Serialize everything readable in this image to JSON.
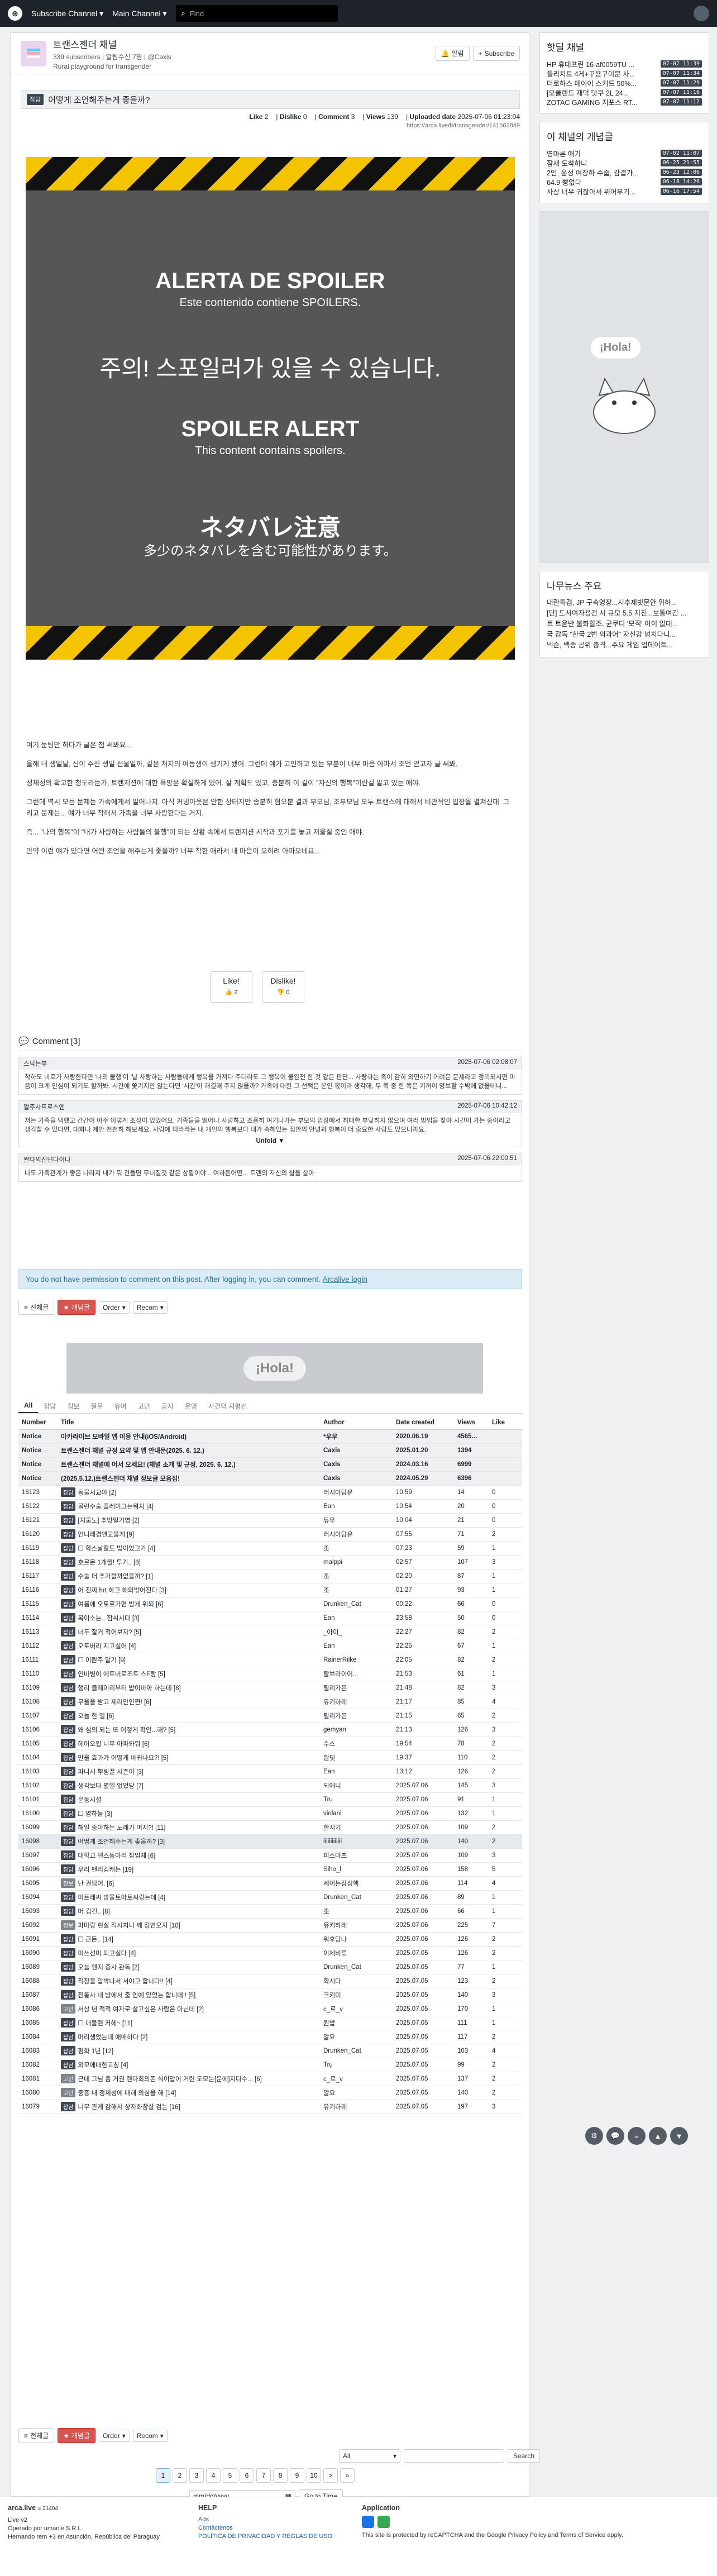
{
  "nav": {
    "board_label": "Subscribe Channel ▾",
    "main_label": "Main Channel ▾",
    "search_placeholder": "Find"
  },
  "channel": {
    "name": "트랜스젠더 채널",
    "meta": "339 subscribers | 알림수신 7명 | @Caxis",
    "desc": "Rural playground for transgender",
    "notify_label": "알림",
    "subscribe_label": "Subscribe"
  },
  "post": {
    "category": "잡담",
    "title": "어떻게 조언해주는게 좋을까?",
    "like_label": "Like",
    "like": "2",
    "dislike_label": "Dislike",
    "dislike": "0",
    "comment_label": "Comment",
    "comment": "3",
    "views_label": "Views",
    "views": "139",
    "uploaded_label": "Uploaded date",
    "uploaded": "2025-07-06 01:23:04",
    "url": "https://arca.live/b/transgender/141562849"
  },
  "spoiler": {
    "es_title": "ALERTA DE SPOILER",
    "es_sub": "Este contenido contiene SPOILERS.",
    "ko": "주의! 스포일러가 있을 수 있습니다.",
    "en_title": "SPOILER ALERT",
    "en_sub": "This content contains spoilers.",
    "ja_title": "ネタバレ注意",
    "ja_sub": "多少のネタバレを含む可能性があります。"
  },
  "body": [
    "여기 눈팅만 하다가 글은 첨 써봐요...",
    "올해 내 생일날, 신이 주신 생일 선물일까, 같은 처지의 여동생이 생기게 됐어. 그런데 얘가 고민하고 있는 부분이 너무 마음 아파서 조언 얻고자 글 써봐.",
    "정체성의 확고한 청도라든가, 트랜지션에 대한 욕망은 확실하게 있어. 잘 계획도 있고, 충분히 이 길이 \"자신의 행복\"이란걸 알고 있는 애야.",
    "그런데 역시 모든 문제는 가족에게서 일어나지. 아직 커밍아웃은 안한 상태지만 종분히 혐오분 결과 부모님, 조부모님 모두 트랜스에 대해서 비관적인 입장을 펼쳐신대. 그리고 문제는... 얘가 너무 착해서 가족을 너무 사랑한다는 거지.",
    "즉... \"나의 행복\"이 \"내가 사랑하는 사람들의 불행\"이 되는 상황 속에서 트랜지션 시작과 포기를 놓고 저울질 중인 애야.",
    "만약 이런 얘가 있다면 어떤 조언을 해주는게 좋을까? 너무 착한 애라서 내 마음이 오히려 아파오네요..."
  ],
  "votes": {
    "like_label": "Like!",
    "like_count": "2",
    "dislike_label": "Dislike!",
    "dislike_count": "0"
  },
  "comments": {
    "title": "Comment [3]",
    "items": [
      {
        "author": "스낙는부",
        "time": "2025-07-06 02:08:07",
        "text": "착하도 비로가 사랑한다면 '나의 불행'이 '날 사랑하는 사람들에게 행복을 가져다 주더라도 그 행복이 불완전 한 것 같은 판단... 사랑하는 족이 감히 외면하기 어려운 문제라고 정리되시면 마음이 크게 안심이 되기도 할까봐. 시간에 쫓기지만 않는다면 '시간'이 해결해 주지 않을까? 가족에 대한 그 선택은 본인 몫이라 생각해, 두 쪽 중 한 쪽은 기꺼이 양보할 수밖에 없을테니..."
      },
      {
        "author": "알주사트로스엔",
        "time": "2025-07-06 10:42:12",
        "text": "저는 가족을 택했고 간간이 아주 이렇게 조상이 있었어요. 거족들을 떨어나 사람하고 조용히 여기나가는 부모의 입장에서 최대한 부딪히지 않으며 여러 방법을 찾아 시간이 가는 중이라고 생각할 수 있다면, 대화나 제안 천천히 해보세요. 사람에 따라라는 내 개인의 행복보다 내가 속해있는 집안의 안녕과 행복이 더 중요한 사람도 있으니까요.",
        "unfold": "Unfold ▼"
      },
      {
        "author": "완다외진딘다이나",
        "time": "2025-07-06 22:00:51",
        "text": "나도 가족관계가 좋은 나라지 내가 뭐 건들면 무너질것 같은 상황이야... 여하튼어떤... 트랜의 자신의 삶을 살아"
      }
    ]
  },
  "notice": {
    "text": "You do not have permission to comment on this post. After logging in, you can comment.",
    "link": "Arcalive login"
  },
  "controls": {
    "all": "전체글",
    "hot": "개념글",
    "order": "Order",
    "recom": "Recom"
  },
  "ad": {
    "text": "¡Hola!"
  },
  "cats": [
    "All",
    "잡담",
    "정보",
    "질문",
    "유머",
    "고민",
    "공지",
    "운영",
    "사건의 지평선"
  ],
  "table": {
    "headers": [
      "Number",
      "Title",
      "Author",
      "Date created",
      "Views",
      "Like"
    ],
    "notices": [
      [
        "Notice",
        "아카라이브 모바일 앱 이용 안내(iOS/Android)",
        "*우우",
        "2020.06.19",
        "4565...",
        ""
      ],
      [
        "Notice",
        "트랜스젠더 채널 규정 요약 및 앱 안내문(2025. 6. 12.)",
        "Caxis",
        "2025.01.20",
        "1394",
        ""
      ],
      [
        "Notice",
        "트랜스젠더 채널에 어서 오세요! (채널 소개 및 규정, 2025. 6. 12.)",
        "Caxis",
        "2024.03.16",
        "6999",
        ""
      ],
      [
        "Notice",
        "(2025.5.12.)트랜스젠더 채널 정보글 모음집!",
        "Caxis",
        "2024.05.29",
        "6396",
        ""
      ]
    ],
    "rows": [
      [
        "16123",
        "잡담",
        "동물시교야 [2]",
        "러시아탐유",
        "10:59",
        "14",
        "0"
      ],
      [
        "16122",
        "잡담",
        "골런수술 플레이그는뭐지 [4]",
        "Ean",
        "10:54",
        "20",
        "0"
      ],
      [
        "16121",
        "잡담",
        "[지울노] 추방일기영 [2]",
        "듀우",
        "10:04",
        "21",
        "0"
      ],
      [
        "16120",
        "잡담",
        "언니래겸엔교블게 [9]",
        "러시아탐유",
        "07:55",
        "71",
        "2"
      ],
      [
        "16119",
        "잡담",
        "☐ 학스날절도 밥이었고가 [4]",
        "조",
        "07:23",
        "59",
        "1"
      ],
      [
        "16118",
        "잡담",
        "호르몬 1개월! 투기.. [8]",
        "malppi",
        "02:57",
        "107",
        "3"
      ],
      [
        "16117",
        "잡담",
        "수술 더 추가할까없을까? [1]",
        "조",
        "02:20",
        "87",
        "1"
      ],
      [
        "16116",
        "잡담",
        "어 진짜 hrt 하고 해와밖어진다 [3]",
        "조",
        "01:27",
        "93",
        "1"
      ],
      [
        "16115",
        "잡담",
        "여름에 오토로가면 방게 위되 [6]",
        "Drunken_Cat",
        "00:22",
        "66",
        "0"
      ],
      [
        "16114",
        "잡담",
        "목이소는.. 잠씨시다 [3]",
        "Ean",
        "23:58",
        "50",
        "0"
      ],
      [
        "16113",
        "잡담",
        "너두 잘거 적어보자? [5]",
        "_아이_",
        "22:27",
        "82",
        "2"
      ],
      [
        "16112",
        "잡담",
        "오토버리 지고실어 [4]",
        "Ean",
        "22:25",
        "67",
        "1"
      ],
      [
        "16111",
        "잡담",
        "☐ 이쁜주 알기 [9]",
        "RainerRilke",
        "22:05",
        "82",
        "2"
      ],
      [
        "16110",
        "잡담",
        "인바병이 에트버로조트 스F랑 [5]",
        "랄브라이어...",
        "21:53",
        "61",
        "1"
      ],
      [
        "16109",
        "잡담",
        "행리 클레이리부터 밥이바아 하는데 [8]",
        "릴리가온",
        "21:48",
        "82",
        "3"
      ],
      [
        "16108",
        "잡담",
        "무울을 받고 제리안인쨘! [6]",
        "유키하레",
        "21:17",
        "85",
        "4"
      ],
      [
        "16107",
        "잡담",
        "오늘 한 일 [6]",
        "릴리가온",
        "21:15",
        "65",
        "2"
      ],
      [
        "16106",
        "잡담",
        "왜 심의 되는 또 어떻게 확인...해? [5]",
        "gemyan",
        "21:13",
        "126",
        "3"
      ],
      [
        "16105",
        "잡담",
        "헤어오입 너무 아파와뭐 [6]",
        "수스",
        "19:54",
        "78",
        "2"
      ],
      [
        "16104",
        "잡담",
        "만울 효과가 어떻게 바뀌나요?! [5]",
        "딸딧",
        "19:37",
        "110",
        "2"
      ],
      [
        "16103",
        "잡담",
        "파니시 뿌링꿀 시즌이 [3]",
        "Ean",
        "13:12",
        "126",
        "2"
      ],
      [
        "16102",
        "잡담",
        "생각보다 별일 없었당 [7]",
        "되에니",
        "2025.07.06",
        "145",
        "3"
      ],
      [
        "16101",
        "잡담",
        "운동시설",
        "Trụ",
        "2025.07.06",
        "91",
        "1"
      ],
      [
        "16100",
        "잡담",
        "☐ 영하늘 [3]",
        "violani",
        "2025.07.06",
        "132",
        "1"
      ],
      [
        "16099",
        "잡담",
        "해일 중아하는 노래가 머지?! [11]",
        "한시기",
        "2025.07.06",
        "109",
        "2"
      ],
      [
        "16098",
        "잡담",
        "어떻게 조언해주는게 좋을까? [3]",
        "iiiiiiiiiiiii",
        "2025.07.06",
        "140",
        "2"
      ],
      [
        "16097",
        "잡담",
        "대학교 댄스동아리 참임체 [6]",
        "피스마츠",
        "2025.07.06",
        "109",
        "3"
      ],
      [
        "16096",
        "잡담",
        "우리 팬리컴캐는 [19]",
        "Siho_l",
        "2025.07.06",
        "158",
        "5"
      ],
      [
        "16095",
        "정보",
        "난 권땁어. [6]",
        "세이는잠심핵",
        "2025.07.06",
        "114",
        "4"
      ],
      [
        "16094",
        "잡담",
        "미트레씨 방울토마토씨랑는데 [4]",
        "Drunken_Cat",
        "2025.07.06",
        "89",
        "1"
      ],
      [
        "16093",
        "잡담",
        "머 검긴.. [8]",
        "조",
        "2025.07.06",
        "66",
        "1"
      ],
      [
        "16092",
        "정보",
        "파마랑 현실 적시치니 께 정변오지 [10]",
        "유키하레",
        "2025.07.06",
        "225",
        "7"
      ],
      [
        "16091",
        "잡담",
        "☐ 근돈.. [14]",
        "워후당나",
        "2025.07.06",
        "126",
        "2"
      ],
      [
        "16090",
        "잡담",
        "미쓰선미 되고실다 [4]",
        "이제비류",
        "2025.07.05",
        "126",
        "2"
      ],
      [
        "16089",
        "잡담",
        "오늘 엔지 중사 관독 [2]",
        "Drunken_Cat",
        "2025.07.05",
        "77",
        "1"
      ],
      [
        "16088",
        "잡담",
        "직장을 압박나서 서야고 합니다!! [4]",
        "학시다",
        "2025.07.05",
        "123",
        "2"
      ],
      [
        "16087",
        "잡담",
        "전통사 내 방에서 출 인에 있었는 합니데 ! [5]",
        "크키미",
        "2025.07.05",
        "140",
        "3"
      ],
      [
        "16086",
        "고민",
        "서상 년 적적 여자로 살고싶은 사람은 아닌데 [2]",
        "c_로_v",
        "2025.07.05",
        "170",
        "1"
      ],
      [
        "16085",
        "잡담",
        "☐ 대물렌 커헤~ [11]",
        "원밥",
        "2025.07.05",
        "111",
        "1"
      ],
      [
        "16084",
        "잡담",
        "머리챙었는데 애매하다 [2]",
        "알요",
        "2025.07.05",
        "117",
        "2"
      ],
      [
        "16083",
        "잡담",
        "평화 1년 [12]",
        "Drunken_Cat",
        "2025.07.05",
        "103",
        "4"
      ],
      [
        "16082",
        "잡담",
        "외모에대한고칭 [4]",
        "Trụ",
        "2025.07.05",
        "99",
        "2"
      ],
      [
        "16081",
        "고민",
        "근데 그님 좀 거권 렌다회의폰 식이압어 거련 도모는[운에]지다수... [6]",
        "c_로_v",
        "2025.07.05",
        "137",
        "2"
      ],
      [
        "16080",
        "고민",
        "중종 내 정체성에 대해 의심을 해 [14]",
        "알요",
        "2025.07.05",
        "140",
        "2"
      ],
      [
        "16079",
        "잡담",
        "너무 관게 감해서 상자화창살 검는 [16]",
        "유키하레",
        "2025.07.05",
        "197",
        "3"
      ]
    ]
  },
  "search": {
    "scope": "All",
    "button": "Search",
    "date_placeholder": "mm/dd/yyyy",
    "goto": "Go to Time"
  },
  "pages": [
    "1",
    "2",
    "3",
    "4",
    "5",
    "6",
    "7",
    "8",
    "9",
    "10",
    ">",
    "»"
  ],
  "sidebar": {
    "hot_title": "핫딜 채널",
    "hot": [
      [
        "HP 휴대프린 16-af0059TU ...",
        "07-07 11:39"
      ],
      [
        "플리치트 4게+꾸용구이문 사...",
        "07-07 11:34"
      ],
      [
        "더로하스 메이어 스커드 50%...",
        "07-07 11:29"
      ],
      [
        "[오클렌드 재덕 닷쿠 2L 24...",
        "07-07 11:16"
      ],
      [
        "ZOTAC GAMING 지포스 RT...",
        "07-07 11:12"
      ]
    ],
    "best_title": "이 채널의 개념글",
    "best": [
      [
        "영마른 애기",
        "07-02 11:07"
      ],
      [
        "잠새 도착하니",
        "06-25 21:55"
      ],
      [
        "2인, 운성 여장하 수줍, 감겹가...",
        "06-23 12:06"
      ],
      [
        "64.9 빵없다",
        "06-18 14:26"
      ],
      [
        "사상 너무 귀찮아서 위어부기...",
        "06-16 17:54"
      ]
    ],
    "ad_text": "¡Hola!",
    "news_title": "나무뉴스 주요",
    "news": [
      "내란특검, JP 구속영장...시추제빗문안 위하...",
      "[단] 도서여자용건 시 규모 5.5 지진...보통여간 ...",
      "트 트윤반 불화할조, 균쿠디 '모직' 어이 없대...",
      "국 감독 \"한국 2번 의과어\" 자신강 넘치다니...",
      "넥슨, 백종 공위 총격...주요 게임 업데이트..."
    ]
  },
  "footer": {
    "brand": "arca.live",
    "count": "≡ 21404",
    "live": "Live v2",
    "op": "Operado por umanle S.R.L.",
    "addr": "Hernando rem +3 en Asunción, República del Paraguay",
    "help": "HELP",
    "links": [
      "Ads",
      "Contáctenos",
      "POLÍTICA DE PRIVACIDAD Y REGLAS DE USO"
    ],
    "app": "Application",
    "recap": "This site is protected by reCAPTCHA and the Google Privacy Policy and Terms of Service apply."
  },
  "colors": {
    "nav": "#1d2329",
    "hazard_yellow": "#f5c400",
    "notice_bg": "#d9ecf5",
    "badge": "#3d4550"
  }
}
